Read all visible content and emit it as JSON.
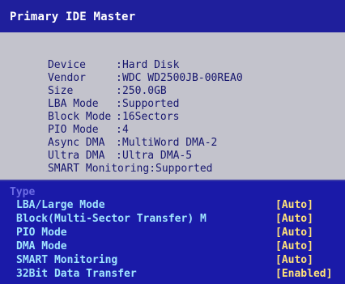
{
  "title": "Primary IDE Master",
  "info": [
    {
      "label": "Device",
      "value": "Hard Disk"
    },
    {
      "label": "Vendor",
      "value": "WDC WD2500JB-00REA0"
    },
    {
      "label": "Size",
      "value": "250.0GB"
    },
    {
      "label": "LBA Mode",
      "value": "Supported"
    },
    {
      "label": "Block Mode",
      "value": "16Sectors"
    },
    {
      "label": "PIO Mode",
      "value": "4"
    },
    {
      "label": "Async DMA",
      "value": "MultiWord DMA-2"
    },
    {
      "label": "Ultra DMA",
      "value": "Ultra DMA-5"
    },
    {
      "label": "SMART Monitoring",
      "value": "Supported"
    }
  ],
  "options_header": "Type",
  "options": [
    {
      "label": "LBA/Large Mode",
      "value": "[Auto]"
    },
    {
      "label": "Block(Multi-Sector Transfer) M",
      "value": "[Auto]"
    },
    {
      "label": "PIO Mode",
      "value": "[Auto]"
    },
    {
      "label": "DMA Mode",
      "value": "[Auto]"
    },
    {
      "label": "SMART Monitoring",
      "value": "[Auto]"
    },
    {
      "label": "32Bit Data Transfer",
      "value": "[Enabled]"
    }
  ],
  "colors": {
    "title_bar": "#1f1f9c",
    "info_bg": "#c3c3cc",
    "info_text": "#17176e",
    "options_bg": "#1a1aa8",
    "option_label": "#9fe4ff",
    "option_value": "#ffe27a",
    "options_header": "#6c6ce4"
  }
}
